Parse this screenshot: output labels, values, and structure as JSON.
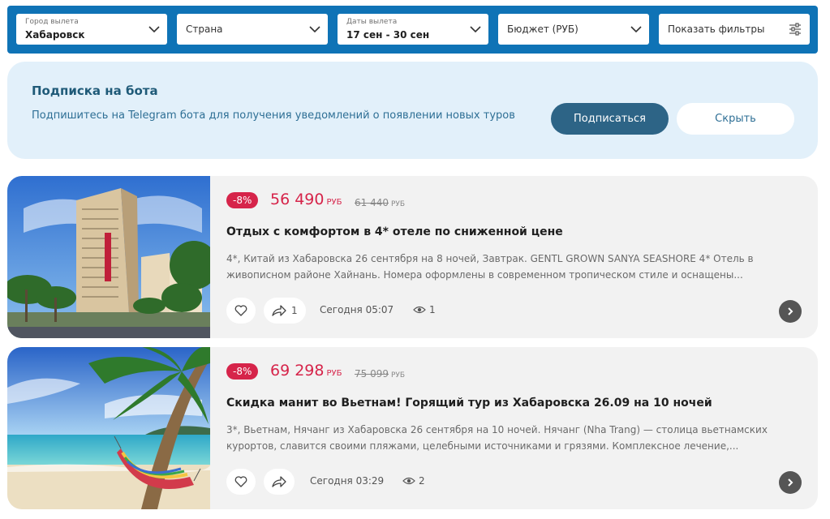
{
  "filters": {
    "city": {
      "label": "Город вылета",
      "value": "Хабаровск"
    },
    "country": {
      "placeholder": "Страна"
    },
    "dates": {
      "label": "Даты вылета",
      "value": "17 сен - 30 сен"
    },
    "budget": {
      "placeholder": "Бюджет (РУБ)"
    },
    "more": {
      "label": "Показать фильтры"
    }
  },
  "subscribe": {
    "title": "Подписка на бота",
    "text": "Подпишитесь на Telegram бота для получения уведомлений о появлении новых туров",
    "subscribe_label": "Подписаться",
    "hide_label": "Скрыть"
  },
  "tours": [
    {
      "discount": "-8%",
      "price": "56 490",
      "currency": "РУБ",
      "old_price": "61 440",
      "old_currency": "РУБ",
      "title": "Отдых с комфортом в 4* отеле по сниженной цене",
      "description": "4*, Китай из Хабаровска 26 сентября на 8 ночей, Завтрак. GENTL GROWN SANYA SEASHORE 4* Отель в живописном районе Хайнань. Номера оформлены в современном тропическом стиле и оснащены...",
      "shares": "1",
      "time": "Сегодня 05:07",
      "views": "1"
    },
    {
      "discount": "-8%",
      "price": "69 298",
      "currency": "РУБ",
      "old_price": "75 099",
      "old_currency": "РУБ",
      "title": "Скидка манит во Вьетнам! Горящий тур из Хабаровска 26.09 на 10 ночей",
      "description": "3*, Вьетнам, Нячанг из Хабаровска 26 сентября на 10 ночей. Нячанг (Nha Trang) — столица вьетнамских курортов, славится своими пляжами, целебными источниками и грязями. Комплексное лечение,...",
      "shares": "",
      "time": "Сегодня 03:29",
      "views": "2"
    }
  ],
  "colors": {
    "filter_bar": "#0f73b6",
    "subscribe_bg": "#e2f0fa",
    "accent_dark_blue": "#2d6486",
    "discount_red": "#d6244a",
    "card_bg": "#f2f2f2"
  }
}
